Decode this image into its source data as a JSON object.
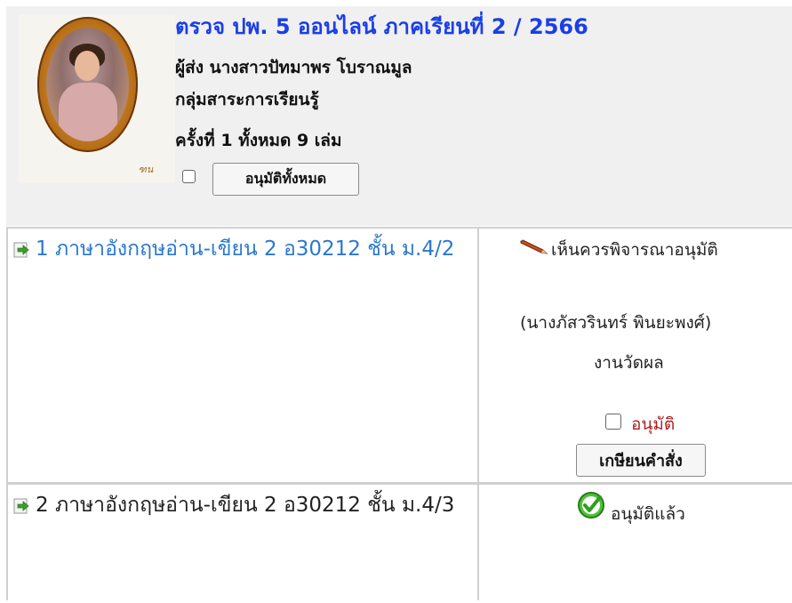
{
  "header": {
    "title": "ตรวจ ปพ. 5 ออนไลน์ ภาคเรียนที่ 2 / 2566",
    "sender": "ผู้ส่ง นางสาวปัทมาพร โบราณมูล",
    "subject_group": "กลุ่มสาระการเรียนรู้",
    "round_info": "ครั้งที่ 1 ทั้งหมด 9 เล่ม",
    "approve_all_label": "อนุมัติทั้งหมด",
    "portrait_emblem_text": "ฑน"
  },
  "rows": [
    {
      "course": "1 ภาษาอังกฤษอ่าน-เขียน 2 อ30212 ชั้น ม.4/2",
      "status_label": "เห็นควรพิจารณาอนุมัติ",
      "reviewer": "(นางภัสวรินทร์ พินยะพงศ์)",
      "department": "งานวัดผล",
      "approve_label": "อนุมัติ",
      "command_button_label": "เกษียนคำสั่ง"
    },
    {
      "course": "2 ภาษาอังกฤษอ่าน-เขียน 2 อ30212 ชั้น ม.4/3",
      "status_label": "อนุมัติแล้ว"
    }
  ],
  "colors": {
    "title": "#1a3ee8",
    "course_link": "#2a78d0",
    "approve_text": "#b02020",
    "approved_icon": "#2e9e1e"
  }
}
